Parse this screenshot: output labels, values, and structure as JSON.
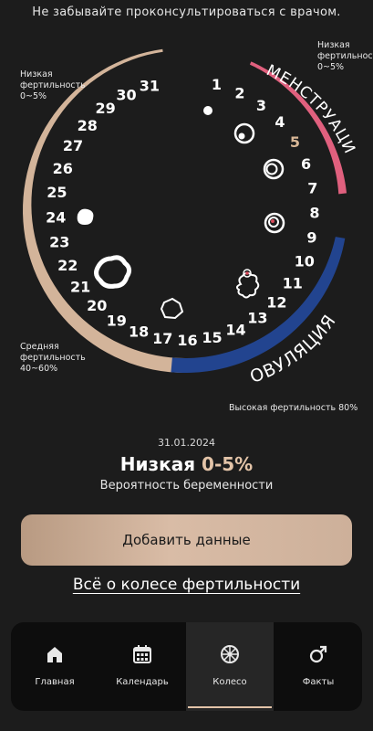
{
  "banner": "Не забывайте проконсультироваться с врачом.",
  "wheel": {
    "days": [
      "1",
      "2",
      "3",
      "4",
      "5",
      "6",
      "7",
      "8",
      "9",
      "10",
      "11",
      "12",
      "13",
      "14",
      "15",
      "16",
      "17",
      "18",
      "19",
      "20",
      "21",
      "22",
      "23",
      "24",
      "25",
      "26",
      "27",
      "28",
      "29",
      "30",
      "31"
    ],
    "current_day": 5,
    "phase_labels": {
      "menstruation": "МЕНСТРУАЦИЯ",
      "ovulation": "ОВУЛЯЦИЯ"
    },
    "side_labels": {
      "top_left": [
        "Низкая",
        "фертильность",
        "0~5%"
      ],
      "top_right": [
        "Низкая",
        "фертильность",
        "0~5%"
      ],
      "bottom_left": [
        "Средняя",
        "фертильность",
        "40~60%"
      ],
      "bottom_right": "Высокая фертильность 80%"
    },
    "colors": {
      "menstruation": "#e0607e",
      "ovulation": "#22448f",
      "base": "#d3b49a",
      "current_day": "#d9b796"
    }
  },
  "status": {
    "date": "31.01.2024",
    "level": "Низкая",
    "range": "0-5%",
    "subtitle": "Вероятность беременности"
  },
  "add_button": "Добавить данные",
  "info_link": "Всё о колесе фертильности",
  "nav": [
    {
      "label": "Главная",
      "icon": "home-icon",
      "active": false
    },
    {
      "label": "Календарь",
      "icon": "calendar-icon",
      "active": false
    },
    {
      "label": "Колесо",
      "icon": "wheel-icon",
      "active": true
    },
    {
      "label": "Факты",
      "icon": "male-symbol-icon",
      "active": false
    }
  ]
}
